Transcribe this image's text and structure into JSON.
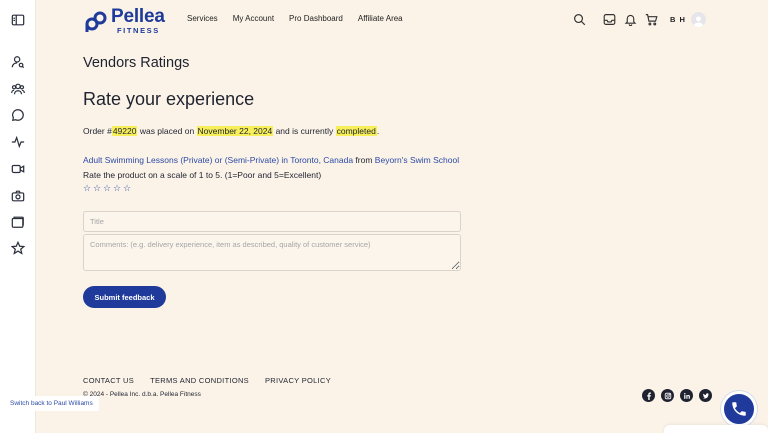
{
  "brand": {
    "name": "Pellea",
    "sub": "FITNESS",
    "color": "#1e3a9a"
  },
  "nav": {
    "items": [
      "Services",
      "My Account",
      "Pro Dashboard",
      "Affiliate Area"
    ]
  },
  "user": {
    "initials": "B H"
  },
  "page": {
    "title": "Vendors Ratings",
    "heading": "Rate your experience",
    "order": {
      "prefix": "Order #",
      "number": "49220",
      "placed_text": " was placed on ",
      "date": "November 22, 2024",
      "status_text": " and is currently ",
      "status": "completed",
      "suffix": "."
    },
    "product": {
      "name": "Adult Swimming Lessons (Private) or (Semi-Private) in Toronto, Canada",
      "from_text": " from ",
      "vendor": "Beyorn's Swim School"
    },
    "scale_text": "Rate the product on a scale of 1 to 5. (1=Poor and 5=Excellent)",
    "stars": [
      "☆",
      "☆",
      "☆",
      "☆",
      "☆"
    ],
    "form": {
      "title_placeholder": "Title",
      "comments_placeholder": "Comments: (e.g. delivery experience, item as described, quality of customer service)",
      "submit_label": "Submit feedback"
    }
  },
  "footer": {
    "links": [
      "CONTACT US",
      "TERMS AND CONDITIONS",
      "PRIVACY POLICY"
    ],
    "copyright": "© 2024 - Pellea Inc. d.b.a. Pellea Fitness",
    "social": [
      "facebook-icon",
      "instagram-icon",
      "linkedin-icon",
      "twitter-icon"
    ]
  },
  "switch_back": "Switch back to Paul Williams",
  "colors": {
    "accent": "#1f3a9a",
    "highlight": "#f6ef5a",
    "background": "#fbf3e8"
  }
}
